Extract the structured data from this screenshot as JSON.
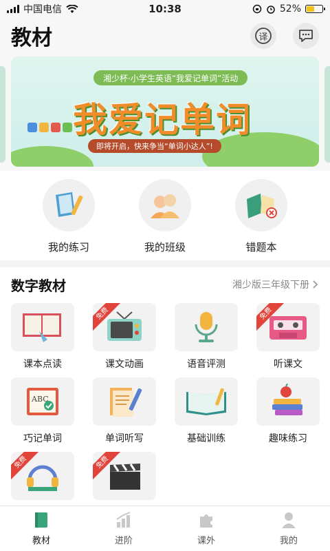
{
  "status_bar": {
    "carrier": "中国电信",
    "time": "10:38",
    "battery_percent": "52%",
    "battery_level": 0.52
  },
  "header": {
    "title": "教材",
    "translate_icon_text": "译"
  },
  "banner": {
    "pill_text": "湘少杯·小学生英语“我爱记单词”活动",
    "title": "我爱记单词",
    "subtitle": "即将开启，快来争当“单词小达人”!"
  },
  "quick_actions": [
    {
      "label": "我的练习",
      "icon": "book-pencil-icon"
    },
    {
      "label": "我的班级",
      "icon": "class-people-icon"
    },
    {
      "label": "错题本",
      "icon": "wrong-answer-book-icon"
    }
  ],
  "section": {
    "title": "数字教材",
    "book_selector": "湘少版三年级下册"
  },
  "free_badge_text": "免费",
  "tiles": [
    {
      "label": "课本点读",
      "icon": "textbook-reading-icon",
      "free": false
    },
    {
      "label": "课文动画",
      "icon": "tv-animation-icon",
      "free": true
    },
    {
      "label": "语音评测",
      "icon": "microphone-icon",
      "free": false
    },
    {
      "label": "听课文",
      "icon": "cassette-tape-icon",
      "free": true
    },
    {
      "label": "巧记单词",
      "icon": "abc-board-icon",
      "free": false
    },
    {
      "label": "单词听写",
      "icon": "dictation-paper-icon",
      "free": false
    },
    {
      "label": "基础训练",
      "icon": "open-book-icon",
      "free": false
    },
    {
      "label": "趣味练习",
      "icon": "apple-books-icon",
      "free": false
    },
    {
      "label": "",
      "icon": "headphones-books-icon",
      "free": true
    },
    {
      "label": "",
      "icon": "clapperboard-icon",
      "free": true
    }
  ],
  "tabbar": [
    {
      "label": "教材",
      "icon": "textbook-tab-icon",
      "active": true
    },
    {
      "label": "进阶",
      "icon": "bar-chart-tab-icon",
      "active": false
    },
    {
      "label": "课外",
      "icon": "puzzle-tab-icon",
      "active": false
    },
    {
      "label": "我的",
      "icon": "person-tab-icon",
      "active": false
    }
  ],
  "colors": {
    "accent_green": "#3aa57a",
    "badge_red": "#e0443b",
    "banner_orange": "#f08c2a"
  }
}
